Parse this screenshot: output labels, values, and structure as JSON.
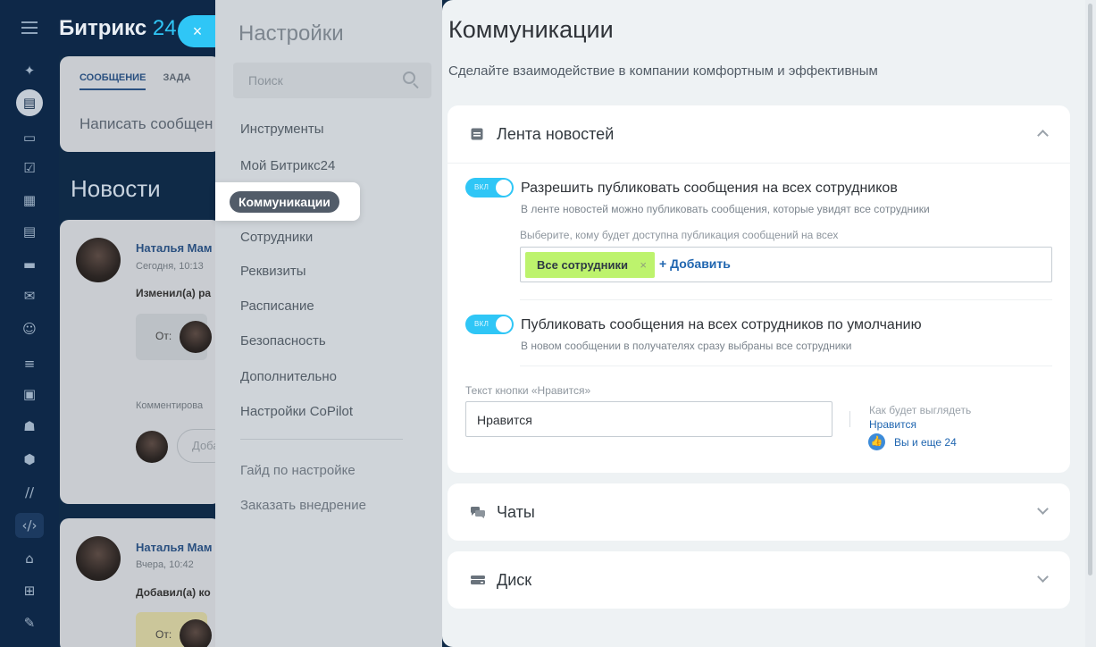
{
  "app": {
    "logo_main": "Битрикс",
    "logo_num": "24",
    "close_label": "×"
  },
  "sidebar_icons": [
    "menu-icon",
    "feed-icon",
    "chat-icon",
    "tasks-icon",
    "calendar-icon",
    "docs-icon",
    "disk-icon",
    "mail-icon",
    "group-icon",
    "filter-icon",
    "crm-icon",
    "robot-icon",
    "store-icon",
    "sales-icon",
    "code-icon",
    "bank-icon",
    "cart-icon",
    "sign-icon"
  ],
  "feed": {
    "tab_message": "СООБЩЕНИЕ",
    "tab_tasks": "ЗАДА",
    "write_message": "Написать сообщен",
    "news_title": "Новости",
    "post1": {
      "author": "Наталья Мам",
      "date": "Сегодня, 10:13",
      "action": "Изменил(а) ра",
      "from": "От:",
      "commented": "Комментирова",
      "comment_placeholder": "Доба"
    },
    "post2": {
      "author": "Наталья Мам",
      "date": "Вчера, 10:42",
      "action": "Добавил(а) ко",
      "from": "От:"
    }
  },
  "settings": {
    "title": "Настройки",
    "search_placeholder": "Поиск",
    "items": [
      {
        "label": "Инструменты"
      },
      {
        "label": "Мой Битрикс24"
      },
      {
        "label": "Коммуникации"
      },
      {
        "label": "Сотрудники"
      },
      {
        "label": "Реквизиты"
      },
      {
        "label": "Расписание"
      },
      {
        "label": "Безопасность"
      },
      {
        "label": "Дополнительно"
      },
      {
        "label": "Настройки CoPilot"
      }
    ],
    "footer_items": [
      {
        "label": "Гайд по настройке"
      },
      {
        "label": "Заказать внедрение"
      }
    ]
  },
  "main": {
    "title": "Коммуникации",
    "subtitle": "Сделайте взаимодействие в компании комфортным и эффективным",
    "news_section": {
      "title": "Лента новостей",
      "toggle_on_label": "ВКЛ",
      "option1_title": "Разрешить публиковать сообщения на всех сотрудников",
      "option1_desc": "В ленте новостей можно публиковать сообщения, которые увидят все сотрудники",
      "audience_label": "Выберите, кому будет доступна публикация сообщений на всех",
      "audience_tag": "Все сотрудники",
      "audience_tag_remove": "×",
      "add_label": "+ Добавить",
      "option2_title": "Публиковать сообщения на всех сотрудников по умолчанию",
      "option2_desc": "В новом сообщении в получателях сразу выбраны все сотрудники",
      "like_button_label": "Текст кнопки «Нравится»",
      "like_button_value": "Нравится",
      "preview_caption": "Как будет выглядеть",
      "preview_like": "Нравится",
      "preview_you": "Вы и еще 24"
    },
    "chats_section": {
      "title": "Чаты"
    },
    "disk_section": {
      "title": "Диск"
    }
  },
  "colors": {
    "accent": "#2fc6f6",
    "link": "#2066b0",
    "tag": "#bdf36d",
    "sidebar_bg": "#0e2848"
  }
}
